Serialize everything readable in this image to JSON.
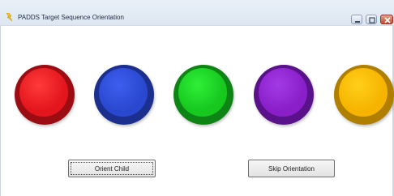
{
  "window": {
    "title": "PADDS Target Sequence Orientation"
  },
  "titlebar_controls": [
    {
      "name": "minimize",
      "icon": "minimize-icon"
    },
    {
      "name": "maximize",
      "icon": "maximize-icon"
    },
    {
      "name": "close",
      "icon": "close-icon"
    }
  ],
  "targets": [
    {
      "name": "red",
      "color": "#e3161d",
      "highlight": "#ff3a3a",
      "shade": "#9b0d12"
    },
    {
      "name": "blue",
      "color": "#2a48cf",
      "highlight": "#3d5ef0",
      "shade": "#1a2f8e"
    },
    {
      "name": "green",
      "color": "#17c81f",
      "highlight": "#2ff038",
      "shade": "#0d8414"
    },
    {
      "name": "purple",
      "color": "#8a1fc9",
      "highlight": "#a23ae6",
      "shade": "#5a128a"
    },
    {
      "name": "yellow",
      "color": "#f6b400",
      "highlight": "#ffcf1a",
      "shade": "#b07f00"
    }
  ],
  "buttons": {
    "orient_child": "Orient Child",
    "skip_orientation": "Skip Orientation"
  }
}
